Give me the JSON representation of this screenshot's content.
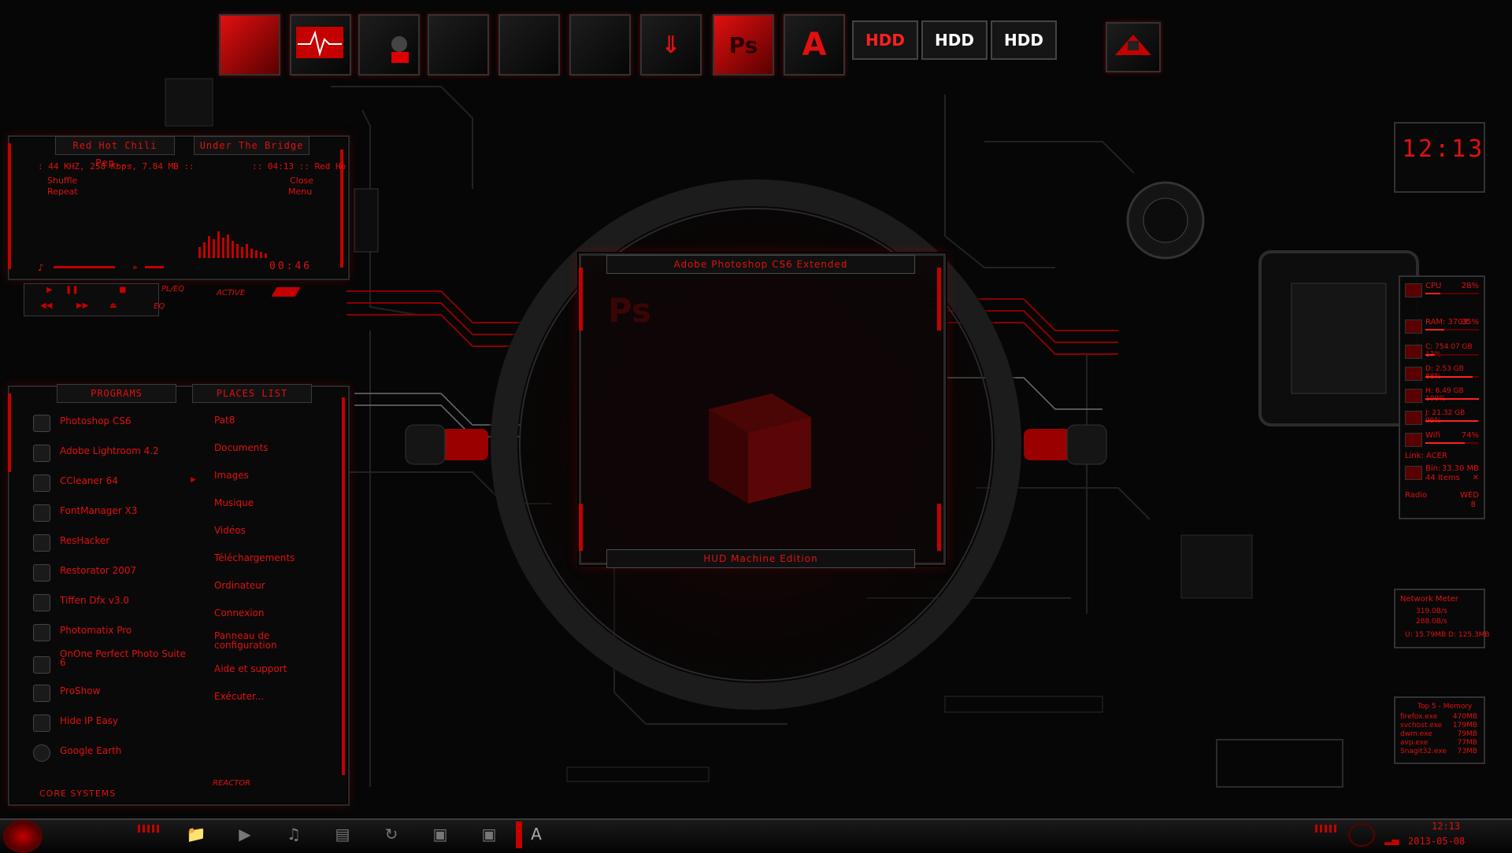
{
  "colors": {
    "accent": "#e01010",
    "dark_red": "#5a0000",
    "background": "#050505",
    "panel": "#0a0a0a"
  },
  "dock": {
    "icons": [
      "monitor-red-icon",
      "heartbeat-monitor-icon",
      "stamp-icon",
      "folder-icon",
      "folder-icon",
      "folder-icon",
      "folder-icon",
      "download-folder-icon",
      "photoshop-cube-icon",
      "adobe-icon"
    ],
    "ps_label": "Ps",
    "adobe_label": "A",
    "hdd_labels": [
      "HDD",
      "HDD",
      "HDD"
    ],
    "end_icon": "user-badge-icon"
  },
  "player": {
    "tab_artist": "Red Hot Chili Pep...",
    "tab_track": "Under The Bridge",
    "info_line": ": 44 KHZ, 258 Kbps, 7.84 MB ::",
    "time_info": ":: 04:13 :: Red Ho",
    "shuffle": "Shuffle",
    "repeat": "Repeat",
    "close": "Close",
    "menu": "Menu",
    "counter": "00:46",
    "mode_label": "PL/EQ",
    "eq_label": "EQ",
    "active_label": "ACTIVE"
  },
  "launcher": {
    "programs_tab": "PROGRAMS",
    "places_tab": "PLACES LIST",
    "programs": [
      {
        "label": "Photoshop CS6",
        "icon": "photoshop-icon"
      },
      {
        "label": "Adobe Lightroom 4.2",
        "icon": "lightroom-icon"
      },
      {
        "label": "CCleaner 64",
        "icon": "ccleaner-icon"
      },
      {
        "label": "FontManager X3",
        "icon": "font-icon"
      },
      {
        "label": "ResHacker",
        "icon": "reshacker-icon"
      },
      {
        "label": "Restorator 2007",
        "icon": "restorator-icon"
      },
      {
        "label": "Tiffen Dfx v3.0",
        "icon": "tiffen-icon"
      },
      {
        "label": "Photomatix Pro",
        "icon": "photomatix-icon"
      },
      {
        "label": "OnOne Perfect Photo Suite 6",
        "icon": "onone-icon"
      },
      {
        "label": "ProShow",
        "icon": "proshow-icon"
      },
      {
        "label": "Hide IP Easy",
        "icon": "lock-icon"
      },
      {
        "label": "Google Earth",
        "icon": "globe-icon"
      }
    ],
    "places": [
      "Pat8",
      "Documents",
      "Images",
      "Musique",
      "Vidéos",
      "Téléchargements",
      "Ordinateur",
      "Connexion",
      "Panneau de configuration",
      "Aide et support",
      "Exécuter..."
    ],
    "footer_left": "CORE SYSTEMS",
    "footer_right": "REACTOR"
  },
  "center": {
    "title": "Adobe Photoshop CS6 Extended",
    "subtitle": "HUD Machine Edition",
    "ps_watermark": "Ps"
  },
  "clock": {
    "time": "12:13"
  },
  "sysmon": {
    "rows": [
      {
        "label": "CPU",
        "value": "28%",
        "fill": 0.28
      },
      {
        "label": "RAM: 3703",
        "value": "35%",
        "fill": 0.35
      },
      {
        "label": "C:  754.07 GB 17%",
        "value": "",
        "fill": 0.17
      },
      {
        "label": "D:    2.53 GB 88%",
        "value": "",
        "fill": 0.88
      },
      {
        "label": "H:    6.49 GB 100%",
        "value": "",
        "fill": 1.0
      },
      {
        "label": "J:    21.32 GB 99%",
        "value": "",
        "fill": 0.99
      },
      {
        "label": "Wifi",
        "value": "74%",
        "fill": 0.74
      }
    ],
    "link": "Link: ACER",
    "bin": "Bin:",
    "bin_size": "33.30 MB",
    "bin_items": "44 Items",
    "radio": "Radio",
    "day": "WED",
    "date_num": "8"
  },
  "network": {
    "title": "Network Meter",
    "down": "319.0B/s",
    "up": "288.0B/s",
    "totals": "U: 15.79MB  D: 125.3MB"
  },
  "top5": {
    "title": "Top 5 - Memory",
    "rows": [
      {
        "name": "firefox.exe",
        "mem": "470MB"
      },
      {
        "name": "svchost.exe",
        "mem": "179MB"
      },
      {
        "name": "dwm.exe",
        "mem": "79MB"
      },
      {
        "name": "avp.exe",
        "mem": "77MB"
      },
      {
        "name": "Snagit32.exe",
        "mem": "73MB"
      }
    ]
  },
  "taskbar": {
    "icons": [
      "start-orb-icon",
      "folder-icon",
      "play-icon",
      "headphones-icon",
      "media-icon",
      "refresh-icon",
      "window-icon",
      "window-icon",
      "adobe-icon"
    ],
    "time": "12:13",
    "date": "2013-05-08"
  }
}
